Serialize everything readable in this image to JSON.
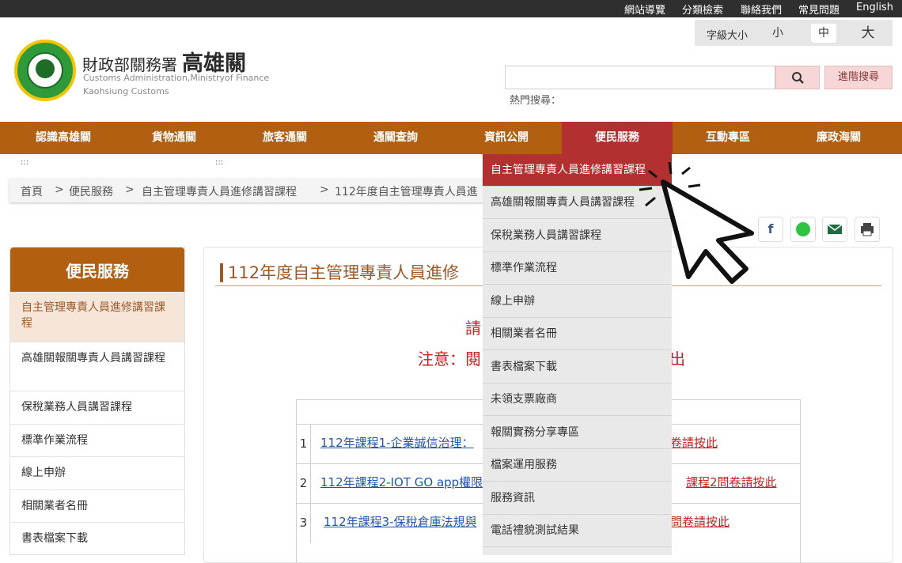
{
  "topbar": {
    "links": [
      "網站導覽",
      "分類檢索",
      "聯絡我們",
      "常見問題",
      "English"
    ]
  },
  "fontsize": {
    "label": "字級大小",
    "small": "小",
    "medium": "中",
    "large": "大",
    "selected": "中"
  },
  "site": {
    "title_prefix": "財政部關務署",
    "title_main": "高雄關",
    "sub1": "Customs Administration,Ministryof Finance",
    "sub2": "Kaohsiung  Customs"
  },
  "search": {
    "value": "",
    "button": "search-icon",
    "advanced": "進階搜尋",
    "hot_label": "熱門搜尋："
  },
  "nav": {
    "items": [
      "認識高雄關",
      "貨物通關",
      "旅客通關",
      "通關查詢",
      "資訊公開",
      "便民服務",
      "互動專區",
      "廉政海關"
    ],
    "active": "便民服務"
  },
  "accesskeys": [
    ":::",
    ":::"
  ],
  "breadcrumb": {
    "home": "首頁",
    "sep": ">",
    "l1": "便民服務",
    "l2": "自主管理專責人員進修講習課程",
    "l3": "112年度自主管理專責人員進"
  },
  "share": [
    "facebook-icon",
    "line-icon",
    "email-icon",
    "print-icon"
  ],
  "sidebar": {
    "title": "便民服務",
    "items": [
      "自主管理專責人員進修講習課程",
      "高雄關報關專責人員講習課程",
      "保稅業務人員講習課程",
      "標準作業流程",
      "線上申辦",
      "相關業者名冊",
      "書表檔案下載"
    ]
  },
  "content": {
    "title": "112年度自主管理專責人員進修",
    "notice1": "請",
    "notice2": "注意：閱",
    "notice2_tail": "出",
    "rows": [
      {
        "num": "1",
        "course": "112年課程1-企業誠信治理：",
        "survey": "卷請按此"
      },
      {
        "num": "2",
        "course": "112年課程2-IOT GO app權限",
        "survey": "課程2問卷請按此"
      },
      {
        "num": "3",
        "course": "112年課程3-保稅倉庫法規與",
        "survey": "問卷請按此"
      }
    ]
  },
  "dropdown": {
    "items": [
      "自主管理專責人員進修講習課程",
      "高雄關報關專責人員講習課程",
      "保稅業務人員講習課程",
      "標準作業流程",
      "線上申辦",
      "相關業者名冊",
      "書表檔案下載",
      "未領支票廠商",
      "報關實務分享專區",
      "檔案運用服務",
      "服務資訊",
      "電話禮貌測試結果"
    ],
    "hovered": "自主管理專責人員進修講習課程"
  },
  "colors": {
    "nav": "#b35f12",
    "active": "#b23030",
    "accent_text": "#9b5a28",
    "notice": "#d12020",
    "link": "#2055b0"
  }
}
